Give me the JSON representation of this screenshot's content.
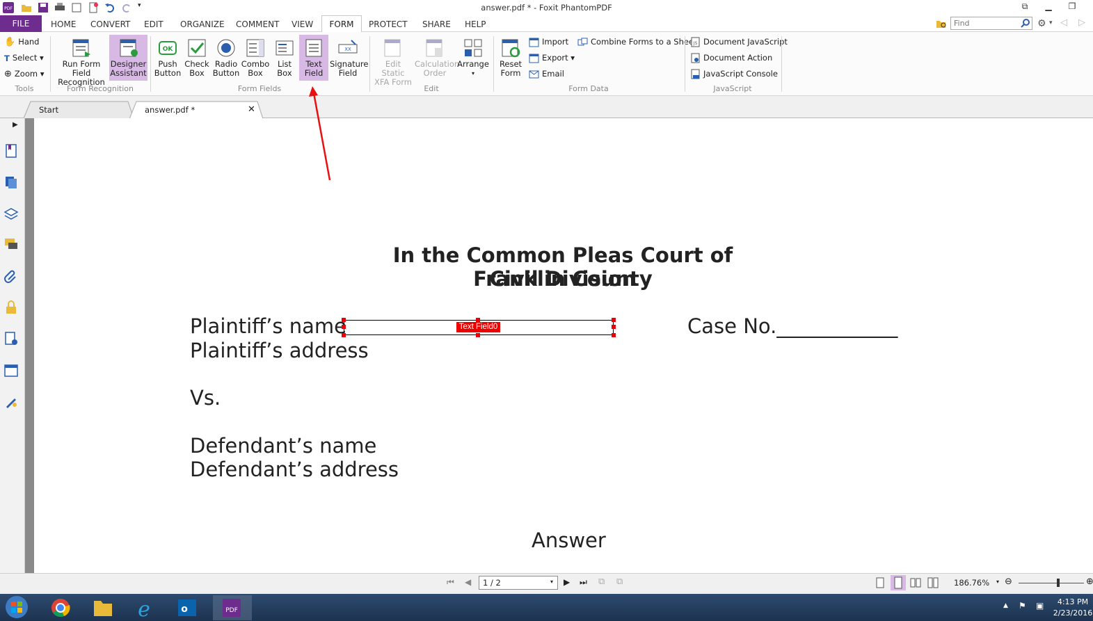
{
  "window": {
    "title": "answer.pdf * - Foxit PhantomPDF"
  },
  "menu": {
    "file": "FILE",
    "tabs": [
      "HOME",
      "CONVERT",
      "EDIT",
      "ORGANIZE",
      "COMMENT",
      "VIEW",
      "FORM",
      "PROTECT",
      "SHARE",
      "HELP"
    ],
    "find_placeholder": "Find"
  },
  "ribbon": {
    "tools": {
      "hand": "Hand",
      "select": "Select",
      "zoom": "Zoom",
      "group": "Tools"
    },
    "form_recognition": {
      "run_l1": "Run Form Field",
      "run_l2": "Recognition",
      "designer_l1": "Designer",
      "designer_l2": "Assistant",
      "group": "Form Recognition"
    },
    "form_fields": {
      "push_l1": "Push",
      "push_l2": "Button",
      "check_l1": "Check",
      "check_l2": "Box",
      "radio_l1": "Radio",
      "radio_l2": "Button",
      "combo_l1": "Combo",
      "combo_l2": "Box",
      "list_l1": "List",
      "list_l2": "Box",
      "text_l1": "Text",
      "text_l2": "Field",
      "sig_l1": "Signature",
      "sig_l2": "Field",
      "group": "Form Fields"
    },
    "edit": {
      "xfa_l1": "Edit Static",
      "xfa_l2": "XFA Form",
      "calc_l1": "Calculation",
      "calc_l2": "Order",
      "arrange": "Arrange",
      "group": "Edit"
    },
    "form_data": {
      "reset_l1": "Reset",
      "reset_l2": "Form",
      "import": "Import",
      "export": "Export",
      "email": "Email",
      "combine": "Combine Forms to a Sheet",
      "group": "Form Data"
    },
    "javascript": {
      "doc_js": "Document JavaScript",
      "doc_action": "Document Action",
      "console": "JavaScript Console",
      "group": "JavaScript"
    }
  },
  "doc_tabs": [
    "Start",
    "answer.pdf *"
  ],
  "document": {
    "title_l1": "In the Common Pleas Court of Franklin County",
    "title_l2": "Civil Division",
    "plaintiff_name": "Plaintiff’s name",
    "plaintiff_address": "Plaintiff’s address",
    "case_no": "Case No.____________",
    "vs": "Vs.",
    "defendant_name": "Defendant’s name",
    "defendant_address": "Defendant’s address",
    "answer": "Answer",
    "field_label": "Text Field0"
  },
  "status": {
    "page": "1 / 2",
    "zoom": "186.76%"
  },
  "clock": {
    "time": "4:13 PM",
    "date": "2/23/2016"
  },
  "colors": {
    "accent": "#6d2c8e",
    "highlight": "#d8b8e4",
    "annotation": "#e00000"
  }
}
